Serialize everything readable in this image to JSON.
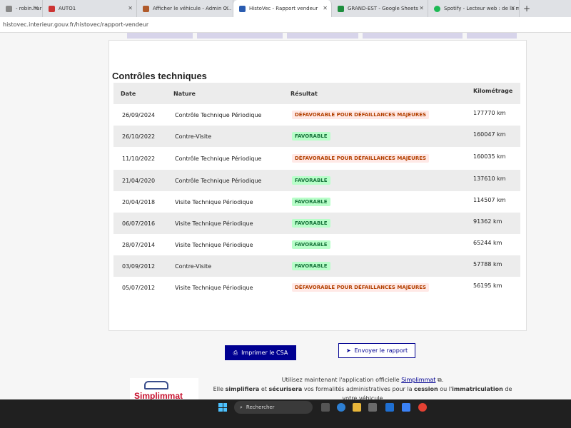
{
  "browser": {
    "tabs": [
      {
        "title": "- robin.harbo",
        "color": "#888888"
      },
      {
        "title": "AUTO1",
        "color": "#cc3333"
      },
      {
        "title": "Afficher le véhicule - Admin C...",
        "color": "#b05a2a"
      },
      {
        "title": "HistoVec - Rapport vendeur",
        "color": "#2a5cb0"
      },
      {
        "title": "GRAND-EST - Google Sheets",
        "color": "#1e8e3e"
      },
      {
        "title": "Spotify - Lecteur web : de la m...",
        "color": "#1db954"
      }
    ],
    "url": "histovec.interieur.gouv.fr/histovec/rapport-vendeur",
    "new_tab_symbol": "+"
  },
  "section": {
    "title": "Contrôles techniques"
  },
  "table": {
    "headers": {
      "date": "Date",
      "nature": "Nature",
      "result": "Résultat",
      "km": "Kilométrage"
    },
    "rows": [
      {
        "date": "26/09/2024",
        "nature": "Contrôle Technique Périodique",
        "result": "DÉFAVORABLE POUR DÉFAILLANCES MAJEURES",
        "status": "def",
        "km": "177770 km"
      },
      {
        "date": "26/10/2022",
        "nature": "Contre-Visite",
        "result": "FAVORABLE",
        "status": "fav",
        "km": "160047 km"
      },
      {
        "date": "11/10/2022",
        "nature": "Contrôle Technique Périodique",
        "result": "DÉFAVORABLE POUR DÉFAILLANCES MAJEURES",
        "status": "def",
        "km": "160035 km"
      },
      {
        "date": "21/04/2020",
        "nature": "Contrôle Technique Périodique",
        "result": "FAVORABLE",
        "status": "fav",
        "km": "137610 km"
      },
      {
        "date": "20/04/2018",
        "nature": "Visite Technique Périodique",
        "result": "FAVORABLE",
        "status": "fav",
        "km": "114507 km"
      },
      {
        "date": "06/07/2016",
        "nature": "Visite Technique Périodique",
        "result": "FAVORABLE",
        "status": "fav",
        "km": "91362 km"
      },
      {
        "date": "28/07/2014",
        "nature": "Visite Technique Périodique",
        "result": "FAVORABLE",
        "status": "fav",
        "km": "65244 km"
      },
      {
        "date": "03/09/2012",
        "nature": "Contre-Visite",
        "result": "FAVORABLE",
        "status": "fav",
        "km": "57788 km"
      },
      {
        "date": "05/07/2012",
        "nature": "Visite Technique Périodique",
        "result": "DÉFAVORABLE POUR DÉFAILLANCES MAJEURES",
        "status": "def",
        "km": "56195 km"
      }
    ]
  },
  "actions": {
    "print_label": "Imprimer le CSA",
    "send_label": "Envoyer le rapport"
  },
  "promo": {
    "logo_text": "Simplimmat",
    "line1_prefix": "Utilisez maintenant l'application officielle",
    "link_text": "Simplimmat",
    "line2_a": "Elle ",
    "simplifiera": "simplifiera",
    "line2_b": " et ",
    "securisera": "sécurisera",
    "line2_c": " vos formalités administratives pour la ",
    "cession": "cession",
    "line2_d": " ou l'",
    "immatriculation": "immatriculation",
    "line2_e": " de",
    "line3": "votre véhicule"
  },
  "taskbar": {
    "search_placeholder": "Rechercher"
  },
  "colors": {
    "primary": "#000091",
    "favorable": "#18753c",
    "defavorable": "#b34000"
  }
}
